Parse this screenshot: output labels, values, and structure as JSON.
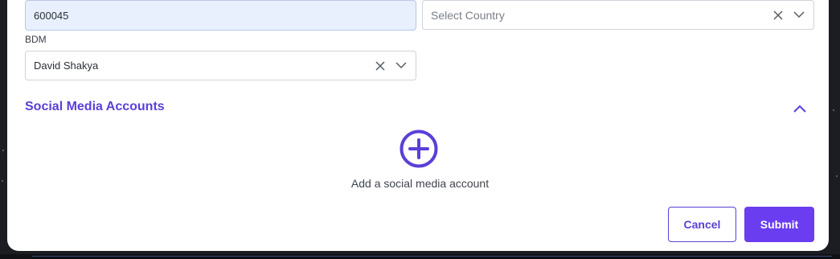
{
  "form": {
    "postal_code": {
      "value": "600045"
    },
    "country": {
      "placeholder": "Select Country"
    },
    "bdm": {
      "label": "BDM",
      "value": "David Shakya"
    }
  },
  "social_media": {
    "title": "Social Media Accounts",
    "add_caption": "Add a social media account"
  },
  "actions": {
    "cancel_label": "Cancel",
    "submit_label": "Submit"
  },
  "icons": {
    "clear": "close-icon",
    "dropdown": "chevron-down-icon",
    "collapse": "chevron-up-icon",
    "add": "plus-circle-icon"
  },
  "colors": {
    "accent": "#5b3fd8",
    "submit_bg": "#6a3df0",
    "filled_input_bg": "#e8f0fe"
  }
}
